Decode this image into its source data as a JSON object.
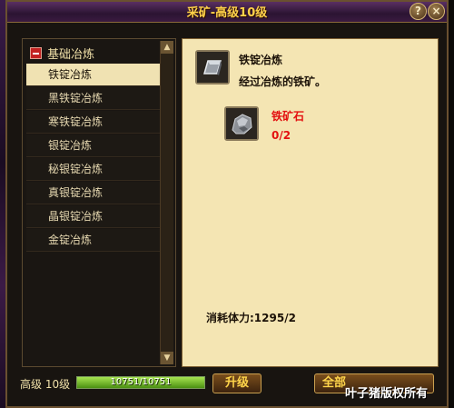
{
  "window": {
    "title": "采矿-高级10级"
  },
  "sidebar": {
    "category": "基础冶炼",
    "items": [
      {
        "label": "铁锭冶炼",
        "selected": true
      },
      {
        "label": "黑铁锭冶炼",
        "selected": false
      },
      {
        "label": "寒铁锭冶炼",
        "selected": false
      },
      {
        "label": "银锭冶炼",
        "selected": false
      },
      {
        "label": "秘银锭冶炼",
        "selected": false
      },
      {
        "label": "真银锭冶炼",
        "selected": false
      },
      {
        "label": "晶银锭冶炼",
        "selected": false
      },
      {
        "label": "金锭冶炼",
        "selected": false
      }
    ]
  },
  "detail": {
    "product_name": "铁锭冶炼",
    "product_desc": "经过冶炼的铁矿。",
    "material_name": "铁矿石",
    "material_count": "0/2",
    "stamina_cost": "消耗体力:1295/2"
  },
  "footer": {
    "level": "高级 10级",
    "exp": "10751/10751",
    "exp_fraction": 1.0,
    "upgrade_label": "升级",
    "all_label": "全部"
  },
  "watermark": {
    "logo": "D平安",
    "text": "叶子猪版权所有"
  },
  "colors": {
    "title": "#ffd24a",
    "selected_item_bg": "#f0e2b2",
    "detail_bg": "#f4e5b3",
    "material_text": "#e31010",
    "exp_bar": "#6bbf2a"
  }
}
